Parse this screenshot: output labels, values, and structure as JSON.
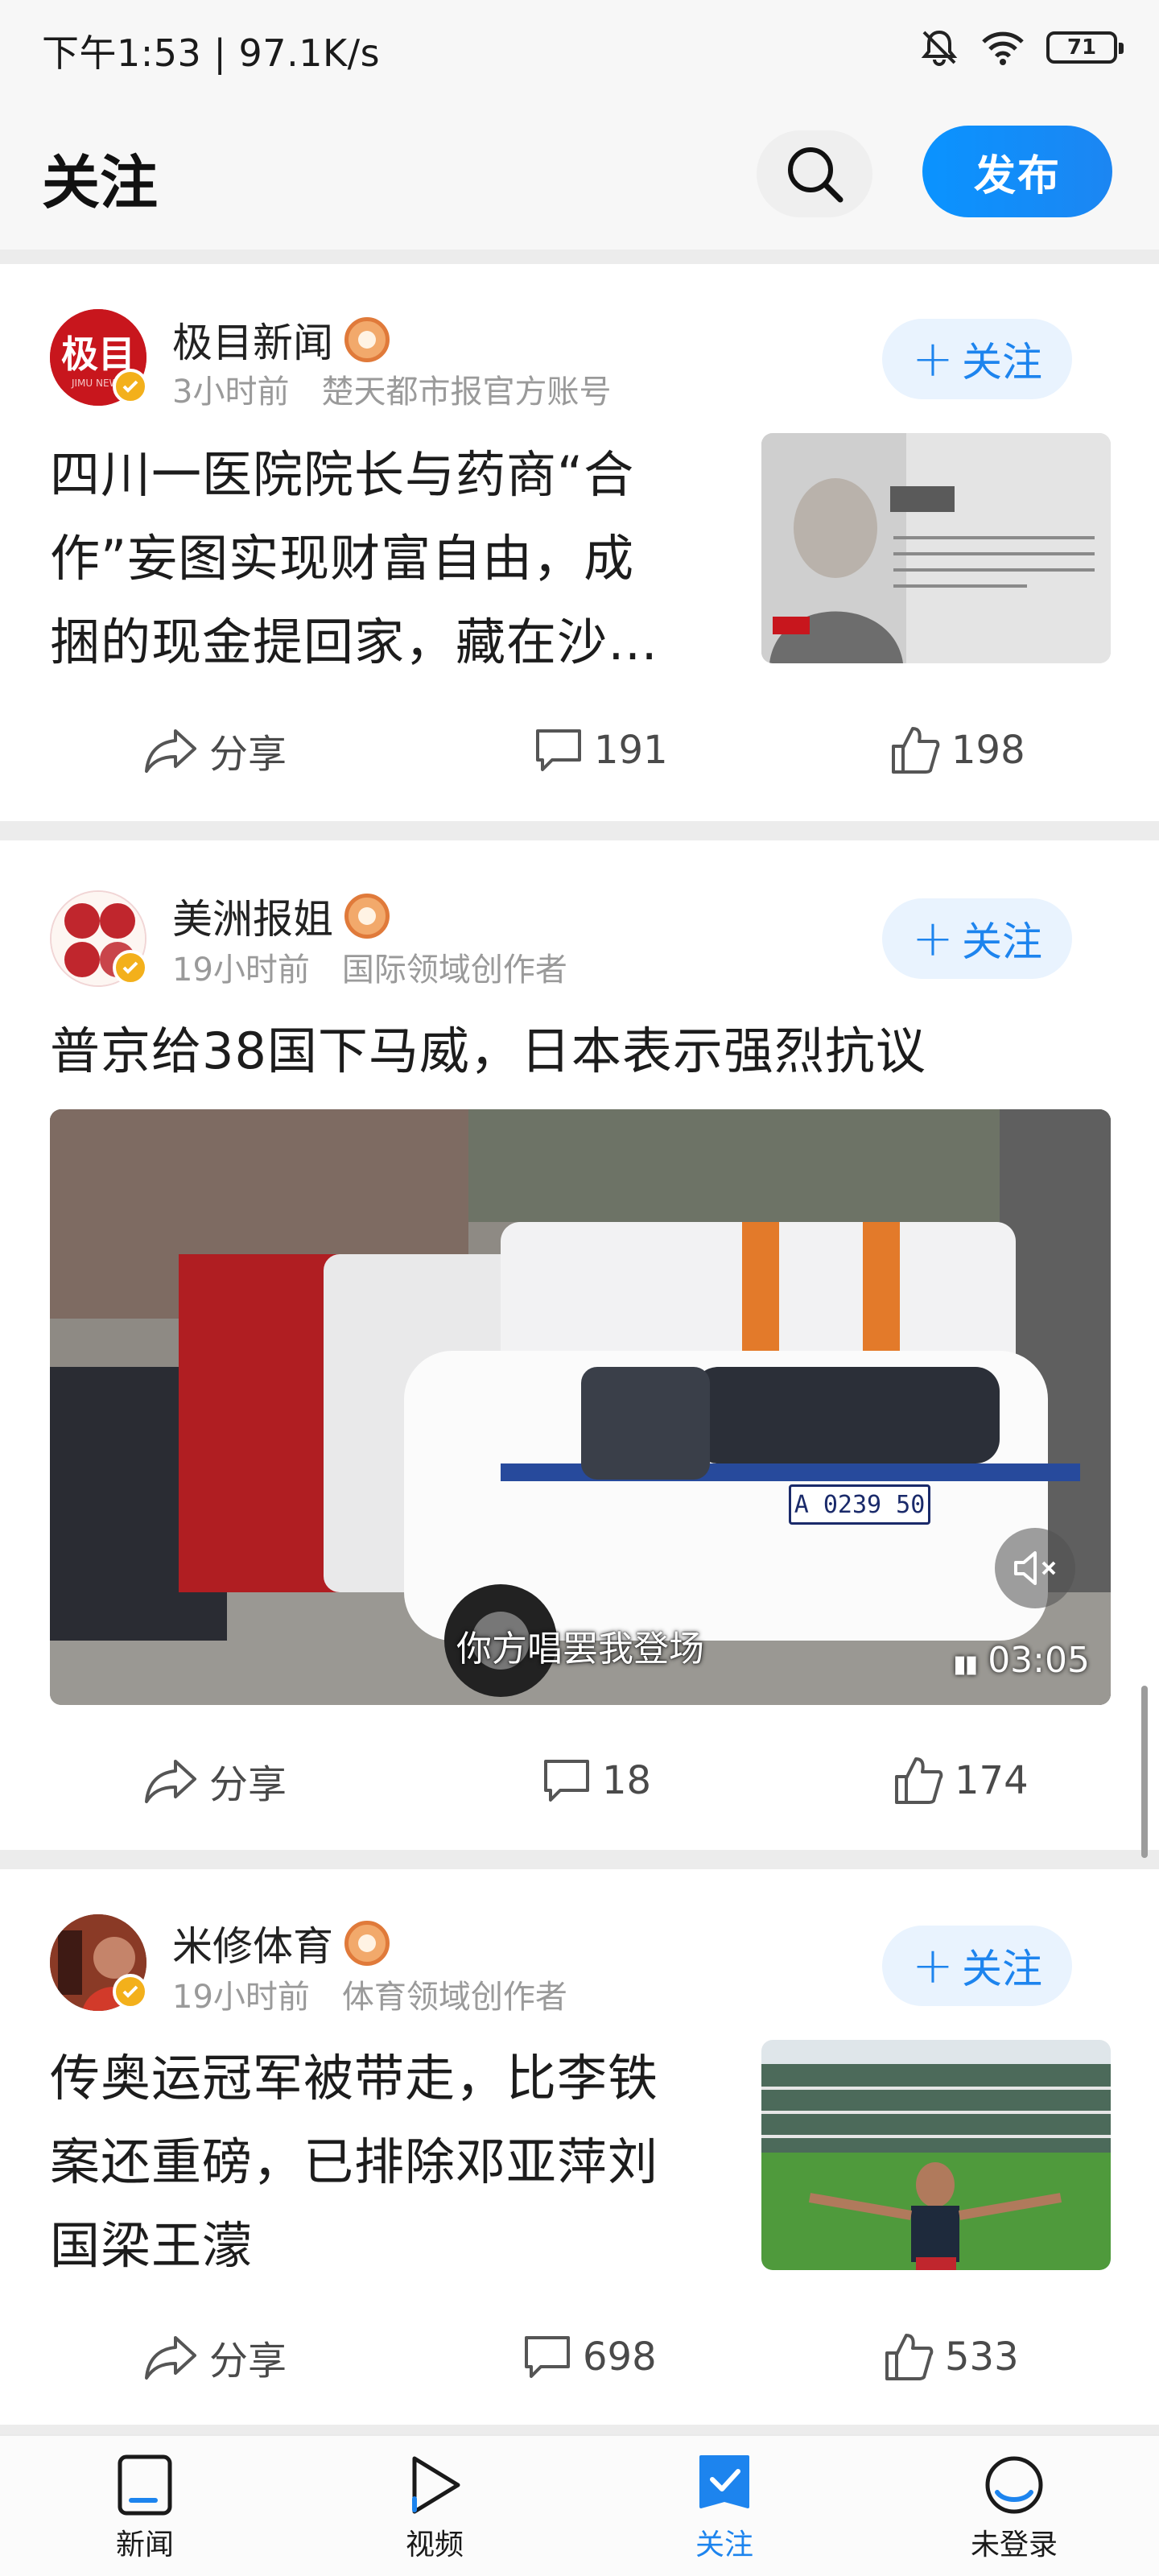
{
  "status_bar": {
    "time_speed": "下午1:53 | 97.1K/s",
    "battery": "71"
  },
  "header": {
    "title": "关注",
    "publish_label": "发布"
  },
  "posts": [
    {
      "author": "极目新闻",
      "time": "3小时前",
      "desc": "楚天都市报官方账号",
      "follow_label": "关注",
      "headline_lines": [
        "四川一医院院长与药商“合",
        "作”妄图实现财富自由，成",
        "捆的现金提回家，藏在沙…"
      ],
      "thumb_caption": "判 决",
      "thumb_text": "2022年12月，刘学鹏因收受贿赂，被判处有期徒刑15年，并处罚金150万元，其违法所得予以全部追缴。",
      "share_label": "分享",
      "comments": "191",
      "likes": "198"
    },
    {
      "author": "美洲报姐",
      "time": "19小时前",
      "desc": "国际领域创作者",
      "follow_label": "关注",
      "headline_lines": [
        "普京给38国下马威，日本表示强烈抗议"
      ],
      "video_subtitle": "你方唱罢我登场",
      "video_duration": "03:05",
      "plate": "A 0239 50",
      "share_label": "分享",
      "comments": "18",
      "likes": "174"
    },
    {
      "author": "米修体育",
      "time": "19小时前",
      "desc": "体育领域创作者",
      "follow_label": "关注",
      "headline_lines": [
        "传奥运冠军被带走，比李铁",
        "案还重磅，已排除邓亚萍刘",
        "国梁王濛"
      ],
      "share_label": "分享",
      "comments": "698",
      "likes": "533"
    }
  ],
  "bottom_nav": [
    {
      "label": "新闻",
      "active": false
    },
    {
      "label": "视频",
      "active": false
    },
    {
      "label": "关注",
      "active": true
    },
    {
      "label": "未登录",
      "active": false
    }
  ],
  "colors": {
    "accent": "#1d84ee",
    "publish_button": "#0a93ff",
    "follow_bg": "#e9f3fe",
    "meta_text": "#9a9a9a",
    "page_bg": "#ececec"
  }
}
